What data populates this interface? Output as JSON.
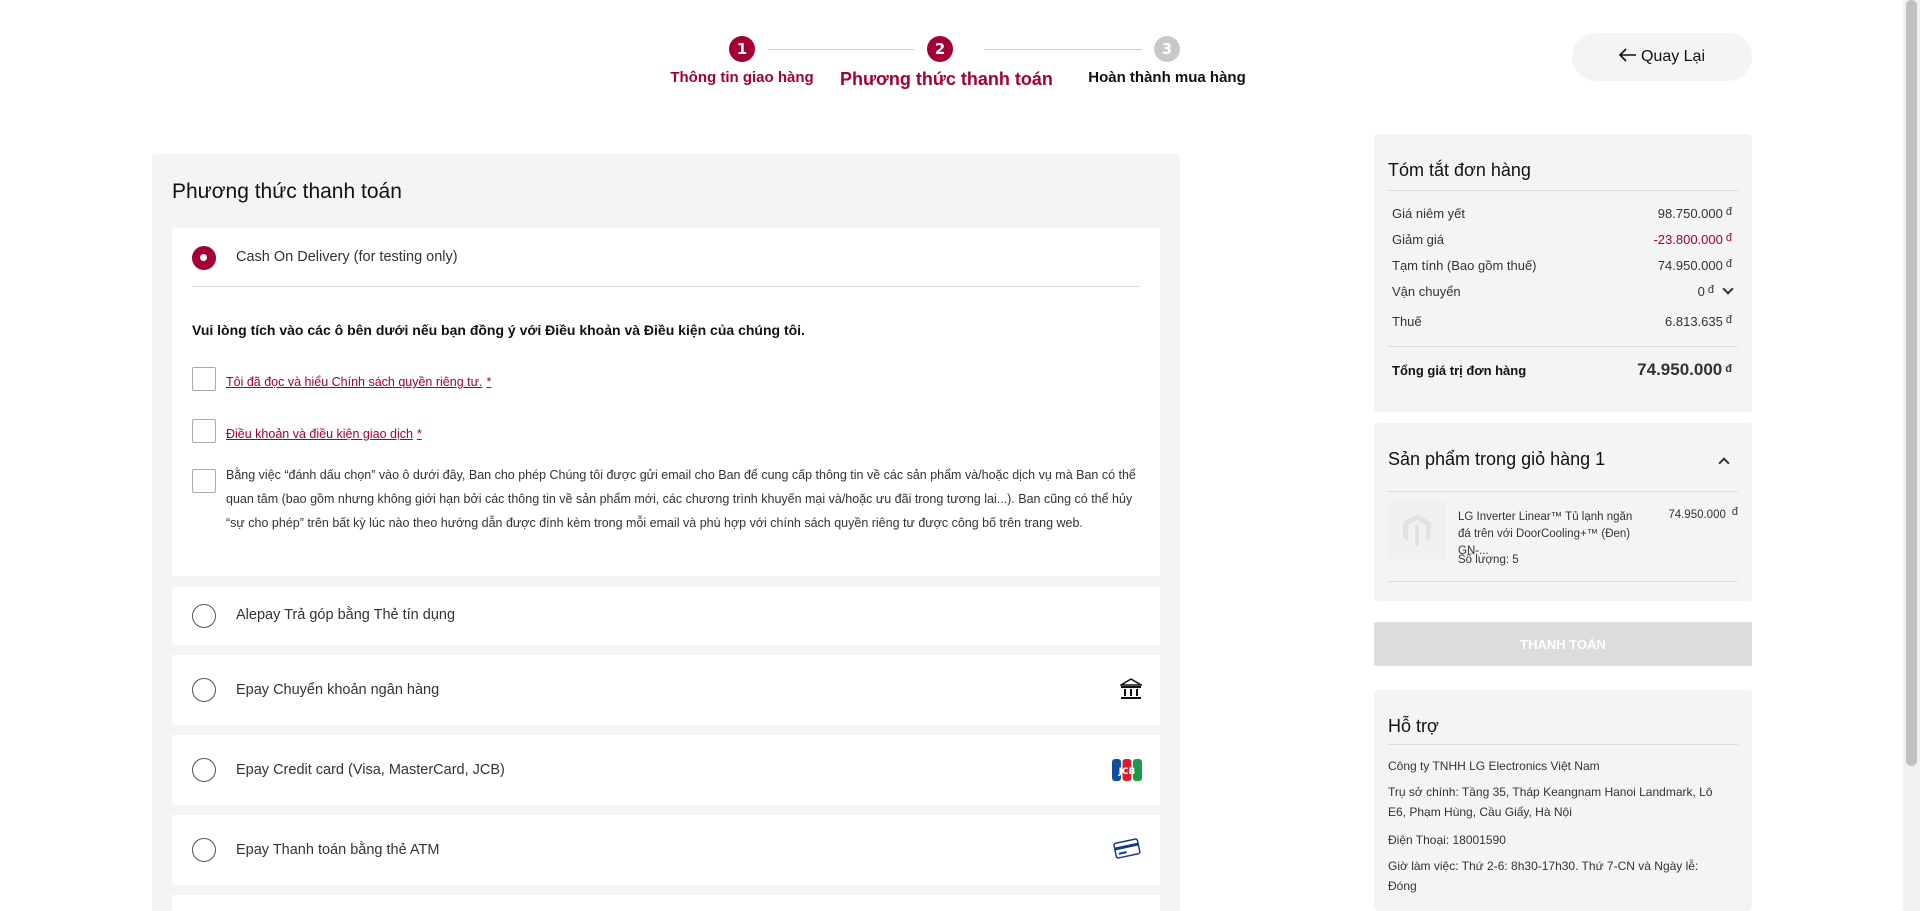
{
  "stepper": {
    "steps": [
      {
        "number": "1",
        "label": "Thông tin giao hàng"
      },
      {
        "number": "2",
        "label": "Phương thức thanh toán"
      },
      {
        "number": "3",
        "label": "Hoàn thành mua hàng"
      }
    ]
  },
  "back_button": {
    "label": "Quay Lại"
  },
  "payment": {
    "title": "Phương thức thanh toán",
    "cod": {
      "label": "Cash On Delivery (for testing only)",
      "selected": true
    },
    "terms_prompt": "Vui lòng tích vào các ô bên dưới nếu bạn đồng ý với Điều khoản và Điều kiện của chúng tôi.",
    "privacy_checkbox": {
      "label": "Tôi đã đọc và hiểu Chính sách quyền riêng tư.",
      "required": "*"
    },
    "terms_checkbox": {
      "label": "Điều khoản và điều kiện giao dịch",
      "required": "*"
    },
    "consent_text": "Bằng việc “đánh dấu chọn” vào ô dưới đây, Ban cho phép Chúng tôi được gửi email cho Ban để cung cấp thông tin về các sản phẩm và/hoặc dịch vụ mà Ban có thể quan tâm (bao gồm nhưng không giới hạn bởi các thông tin về sản phẩm mới, các chương trình khuyến mại và/hoặc ưu đãi trong tương lai...). Ban cũng có thể hủy “sự cho phép” trên bất kỳ lúc nào theo hướng dẫn được đính kèm trong mỗi email và phù hợp với chính sách quyền riêng tư được công bố trên trang web.",
    "options": [
      {
        "label": "Alepay Trả góp bằng Thẻ tín dụng",
        "icon": ""
      },
      {
        "label": "Epay Chuyển khoản ngân hàng",
        "icon": "bank-icon"
      },
      {
        "label": "Epay Credit card (Visa, MasterCard, JCB)",
        "icon": "jcb-icon"
      },
      {
        "label": "Epay Thanh toán bằng thẻ ATM",
        "icon": "atm-card-icon"
      }
    ]
  },
  "summary": {
    "title": "Tóm tắt đơn hàng",
    "currency": "đ",
    "rows": [
      {
        "label": "Giá niêm yết",
        "value": "98.750.000"
      },
      {
        "label": "Giảm giá",
        "value": "-23.800.000"
      },
      {
        "label": "Tạm tính (Bao gồm thuế)",
        "value": "74.950.000"
      },
      {
        "label": "Vận chuyển",
        "value": "0"
      },
      {
        "label": "Thuế",
        "value": "6.813.635"
      }
    ],
    "total_label": "Tổng giá trị đơn hàng",
    "total_value": "74.950.000"
  },
  "cart": {
    "title": "Sản phẩm trong giỏ hàng 1",
    "product_name": "LG Inverter Linear™ Tủ lạnh ngăn đá trên với DoorCooling+™ (Đen) GN-...",
    "product_price": "74.950.000",
    "quantity_label": "Số lượng: 5"
  },
  "pay_button": {
    "label": "THANH TOÁN"
  },
  "support": {
    "title": "Hỗ trợ",
    "company": "Công ty TNHH LG Electronics Việt Nam",
    "address": "Trụ sở chính: Tầng 35, Tháp Keangnam Hanoi Landmark, Lô E6, Phạm Hùng, Cầu Giấy, Hà Nội",
    "phone": "Điện Thoại: 18001590",
    "hours": "Giờ làm việc: Thứ 2-6: 8h30-17h30. Thứ 7-CN và Ngày lễ: Đóng"
  },
  "colors": {
    "brand": "#a50034",
    "panel": "#f4f4f4"
  }
}
